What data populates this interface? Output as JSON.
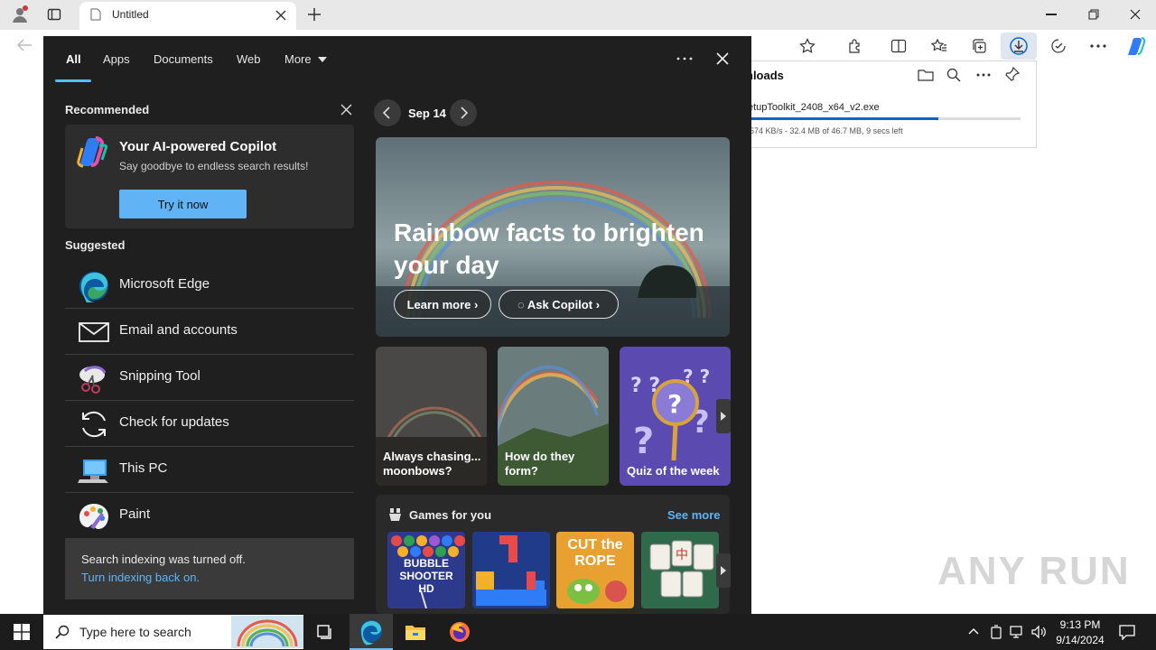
{
  "browser": {
    "tab_title": "Untitled",
    "colors": {
      "accent": "#0a66c2",
      "copilot": "#1f78ff"
    }
  },
  "downloads": {
    "title": "nloads",
    "file": "etupToolkit_2408_x64_v2.exe",
    "progress": 0.7,
    "status": "574 KB/s - 32.4 MB of 46.7 MB, 9 secs left"
  },
  "search_panel": {
    "tabs": [
      {
        "label": "All"
      },
      {
        "label": "Apps"
      },
      {
        "label": "Documents"
      },
      {
        "label": "Web"
      },
      {
        "label": "More"
      }
    ],
    "recommended": {
      "heading": "Recommended",
      "title": "Your AI-powered Copilot",
      "subtitle": "Say goodbye to endless search results!",
      "button": "Try it now"
    },
    "suggested": {
      "heading": "Suggested",
      "items": [
        {
          "label": "Microsoft Edge",
          "icon": "edge-icon"
        },
        {
          "label": "Email and accounts",
          "icon": "mail-icon"
        },
        {
          "label": "Snipping Tool",
          "icon": "snipping-tool-icon"
        },
        {
          "label": "Check for updates",
          "icon": "refresh-icon"
        },
        {
          "label": "This PC",
          "icon": "computer-icon"
        },
        {
          "label": "Paint",
          "icon": "paint-icon"
        }
      ]
    },
    "indexing": {
      "message": "Search indexing was turned off.",
      "link": "Turn indexing back on."
    }
  },
  "highlights": {
    "date": "Sep 14",
    "hero": {
      "title": "Rainbow facts to brighten your day",
      "learn_more": "Learn more",
      "ask_copilot": "Ask Copilot"
    },
    "cards": [
      {
        "label": "Always chasing... moonbows?"
      },
      {
        "label": "How do they form?"
      },
      {
        "label": "Quiz of the week"
      }
    ],
    "games": {
      "heading": "Games for you",
      "see_more": "See more",
      "items": [
        {
          "label": "BUBBLE SHOOTER HD"
        },
        {
          "label": ""
        },
        {
          "label": "CUT the ROPE"
        },
        {
          "label": ""
        }
      ]
    }
  },
  "taskbar": {
    "search_placeholder": "Type here to search",
    "time": "9:13 PM",
    "date": "9/14/2024"
  },
  "watermark": "ANY RUN"
}
